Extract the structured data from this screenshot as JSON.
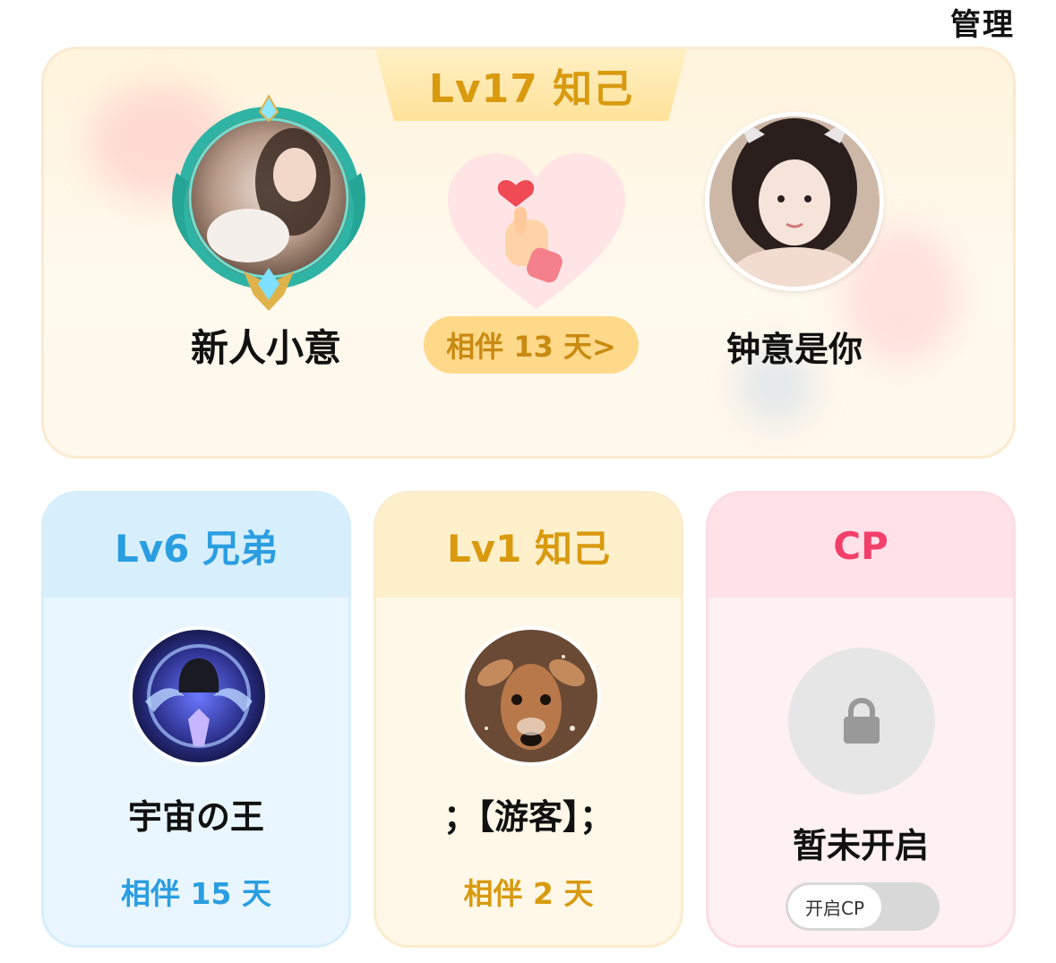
{
  "header": {
    "manage_label": "管理"
  },
  "featured": {
    "level_label": "Lv17 知己",
    "left_user": {
      "name": "新人小意"
    },
    "right_user": {
      "name": "钟意是你"
    },
    "days_label": "相伴 13 天>"
  },
  "cards": [
    {
      "level_label": "Lv6 兄弟",
      "name": "宇宙の王",
      "days_label": "相伴 15 天"
    },
    {
      "level_label": "Lv1 知己",
      "name": "；【游客】；",
      "days_label": "相伴 2 天"
    },
    {
      "level_label": "CP",
      "name": "暂未开启",
      "toggle_label": "开启CP"
    }
  ],
  "colors": {
    "gold": "#d99a10",
    "blue": "#2a9ee0",
    "pink": "#f2406b"
  }
}
